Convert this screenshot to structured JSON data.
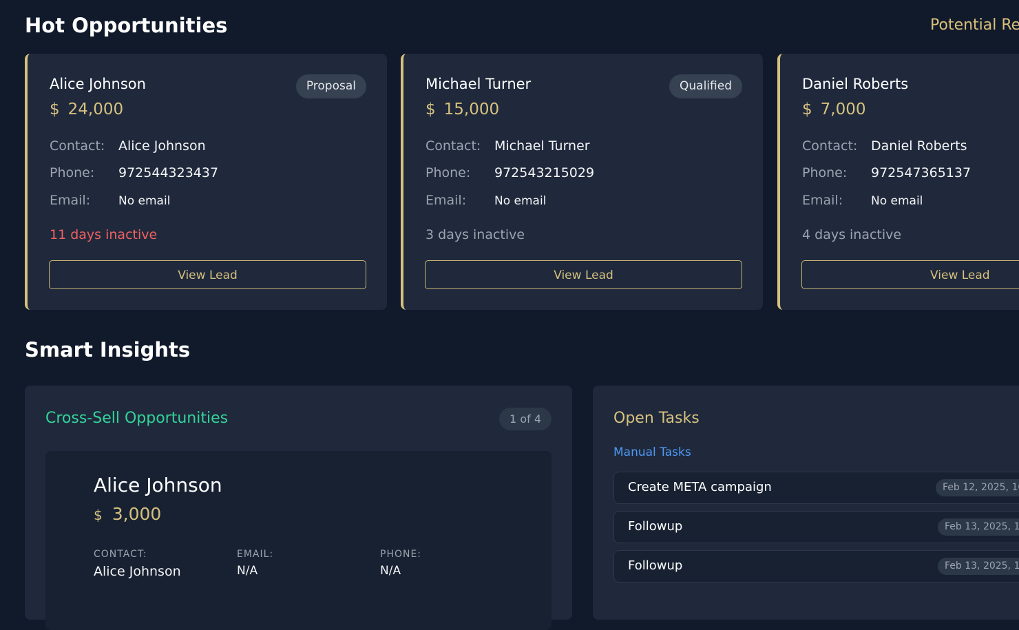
{
  "hot_opportunities": {
    "title": "Hot Opportunities",
    "potential_revenue_label": "Potential Re",
    "cards": [
      {
        "name": "Alice Johnson",
        "stage": "Proposal",
        "currency": "$",
        "amount": "24,000",
        "contact_label": "Contact:",
        "contact": "Alice Johnson",
        "phone_label": "Phone:",
        "phone": "972544323437",
        "email_label": "Email:",
        "email": "No email",
        "inactive": "11 days inactive",
        "view_label": "View Lead"
      },
      {
        "name": "Michael Turner",
        "stage": "Qualified",
        "currency": "$",
        "amount": "15,000",
        "contact_label": "Contact:",
        "contact": "Michael Turner",
        "phone_label": "Phone:",
        "phone": "972543215029",
        "email_label": "Email:",
        "email": "No email",
        "inactive": "3 days inactive",
        "view_label": "View Lead"
      },
      {
        "name": "Daniel Roberts",
        "stage": "",
        "currency": "$",
        "amount": "7,000",
        "contact_label": "Contact:",
        "contact": "Daniel Roberts",
        "phone_label": "Phone:",
        "phone": "972547365137",
        "email_label": "Email:",
        "email": "No email",
        "inactive": "4 days inactive",
        "view_label": "View Lead"
      }
    ]
  },
  "smart_insights": {
    "title": "Smart Insights",
    "cross_sell": {
      "title": "Cross-Sell Opportunities",
      "pager": "1 of 4",
      "item": {
        "name": "Alice Johnson",
        "currency": "$",
        "amount": "3,000",
        "contact_label": "CONTACT:",
        "contact": "Alice Johnson",
        "email_label": "EMAIL:",
        "email": "N/A",
        "phone_label": "PHONE:",
        "phone": "N/A"
      }
    },
    "open_tasks": {
      "title": "Open Tasks",
      "manual_label": "Manual Tasks",
      "tasks": [
        {
          "title": "Create META campaign",
          "date": "Feb 12, 2025, 10"
        },
        {
          "title": "Followup",
          "date": "Feb 13, 2025, 1"
        },
        {
          "title": "Followup",
          "date": "Feb 13, 2025, 1"
        }
      ]
    }
  },
  "colors": {
    "background": "#111a2b",
    "card": "#1f293b",
    "accent_gold": "#d6c17f",
    "accent_green": "#34d399",
    "accent_blue": "#4f9af8",
    "alert_red": "#f06262"
  }
}
